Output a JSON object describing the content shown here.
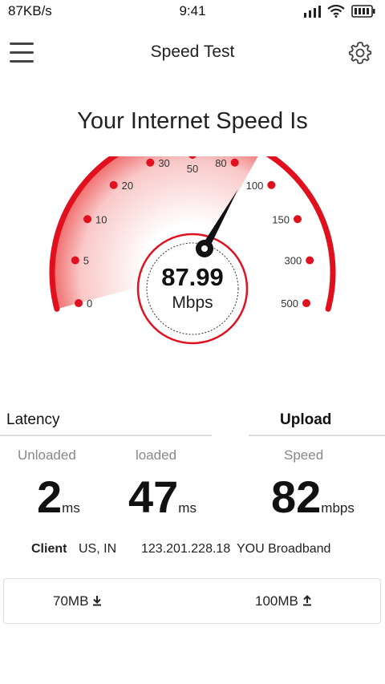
{
  "status_bar": {
    "net_speed": "87KB/s",
    "time": "9:41"
  },
  "header": {
    "title": "Speed Test"
  },
  "headline": "Your Internet Speed Is",
  "gauge": {
    "scale_labels": [
      "0",
      "5",
      "10",
      "20",
      "30",
      "50",
      "80",
      "100",
      "150",
      "300",
      "500"
    ],
    "value": "87.99",
    "unit": "Mbps",
    "accent": "#e0101e"
  },
  "latency": {
    "title": "Latency",
    "unloaded_label": "Unloaded",
    "unloaded_value": "2",
    "unloaded_unit": "ms",
    "loaded_label": "loaded",
    "loaded_value": "47",
    "loaded_unit": "ms"
  },
  "upload": {
    "title": "Upload",
    "speed_label": "Speed",
    "speed_value": "82",
    "speed_unit": "mbps"
  },
  "client": {
    "label": "Client",
    "location": "US, IN",
    "ip": "123.201.228.18",
    "isp": "YOU Broadband"
  },
  "data_usage": {
    "download": "70MB",
    "upload": "100MB"
  }
}
